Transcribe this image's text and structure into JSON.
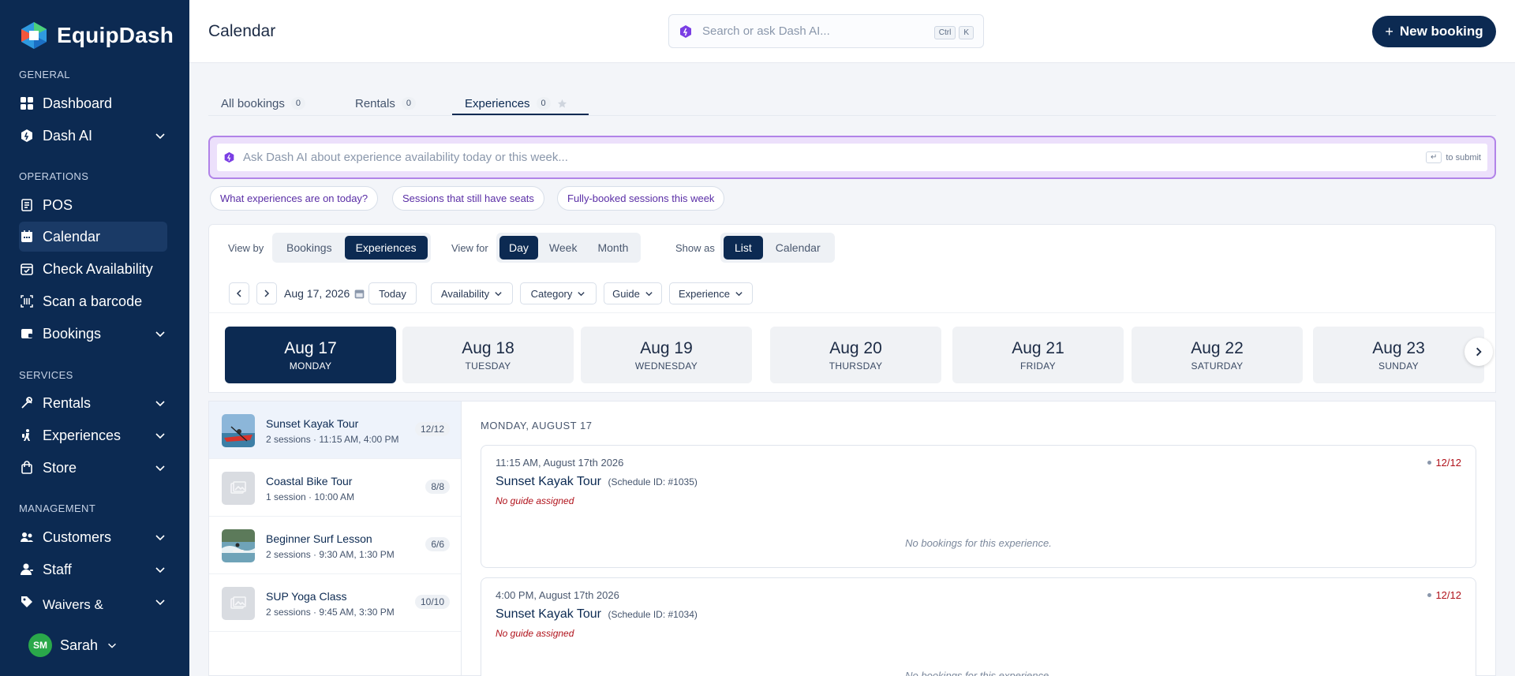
{
  "app": {
    "name": "EquipDash"
  },
  "sidebar": {
    "sections": [
      {
        "label": "GENERAL"
      },
      {
        "label": "OPERATIONS"
      },
      {
        "label": "SERVICES"
      },
      {
        "label": "MANAGEMENT"
      }
    ],
    "items": [
      {
        "label": "Dashboard"
      },
      {
        "label": "Dash AI"
      },
      {
        "label": "POS"
      },
      {
        "label": "Calendar"
      },
      {
        "label": "Check Availability"
      },
      {
        "label": "Scan a barcode"
      },
      {
        "label": "Bookings"
      },
      {
        "label": "Rentals"
      },
      {
        "label": "Experiences"
      },
      {
        "label": "Store"
      },
      {
        "label": "Customers"
      },
      {
        "label": "Staff"
      },
      {
        "label": "Waivers & Forms"
      }
    ],
    "user": {
      "initials": "SM",
      "name": "Sarah"
    }
  },
  "header": {
    "title": "Calendar",
    "search_placeholder": "Search or ask Dash AI...",
    "kbd_ctrl": "Ctrl",
    "kbd_k": "K",
    "new_booking": "New booking"
  },
  "tabs": [
    {
      "label": "All bookings",
      "count": "0"
    },
    {
      "label": "Rentals",
      "count": "0"
    },
    {
      "label": "Experiences",
      "count": "0"
    }
  ],
  "ai": {
    "placeholder": "Ask Dash AI about experience availability today or this week...",
    "enter": "↵",
    "hint": "to submit",
    "suggestions": [
      "What experiences are on today?",
      "Sessions that still have seats",
      "Fully-booked sessions this week"
    ]
  },
  "filters": {
    "view_by_label": "View by",
    "view_by": [
      "Bookings",
      "Experiences"
    ],
    "view_for_label": "View for",
    "view_for": [
      "Day",
      "Week",
      "Month"
    ],
    "show_as_label": "Show as",
    "show_as": [
      "List",
      "Calendar"
    ],
    "date": "Aug 17, 2026",
    "today": "Today",
    "dropdowns": [
      "Availability",
      "Category",
      "Guide",
      "Experience"
    ]
  },
  "days": [
    {
      "date": "Aug 17",
      "name": "MONDAY"
    },
    {
      "date": "Aug 18",
      "name": "TUESDAY"
    },
    {
      "date": "Aug 19",
      "name": "WEDNESDAY"
    },
    {
      "date": "Aug 20",
      "name": "THURSDAY"
    },
    {
      "date": "Aug 21",
      "name": "FRIDAY"
    },
    {
      "date": "Aug 22",
      "name": "SATURDAY"
    },
    {
      "date": "Aug 23",
      "name": "SUNDAY"
    }
  ],
  "experiences": [
    {
      "name": "Sunset Kayak Tour",
      "sub": "2 sessions · 11:15 AM, 4:00 PM",
      "count": "12/12"
    },
    {
      "name": "Coastal Bike Tour",
      "sub": "1 session · 10:00 AM",
      "count": "8/8"
    },
    {
      "name": "Beginner Surf Lesson",
      "sub": "2 sessions · 9:30 AM, 1:30 PM",
      "count": "6/6"
    },
    {
      "name": "SUP Yoga Class",
      "sub": "2 sessions · 9:45 AM, 3:30 PM",
      "count": "10/10"
    }
  ],
  "detail": {
    "title": "MONDAY, AUGUST 17",
    "sessions": [
      {
        "time": "11:15 AM, August 17th 2026",
        "name": "Sunset Kayak Tour",
        "schedule": "(Schedule ID: #1035)",
        "guide": "No guide assigned",
        "capacity": "12/12",
        "empty": "No bookings for this experience."
      },
      {
        "time": "4:00 PM, August 17th 2026",
        "name": "Sunset Kayak Tour",
        "schedule": "(Schedule ID: #1034)",
        "guide": "No guide assigned",
        "capacity": "12/12",
        "empty": "No bookings for this experience."
      }
    ]
  }
}
